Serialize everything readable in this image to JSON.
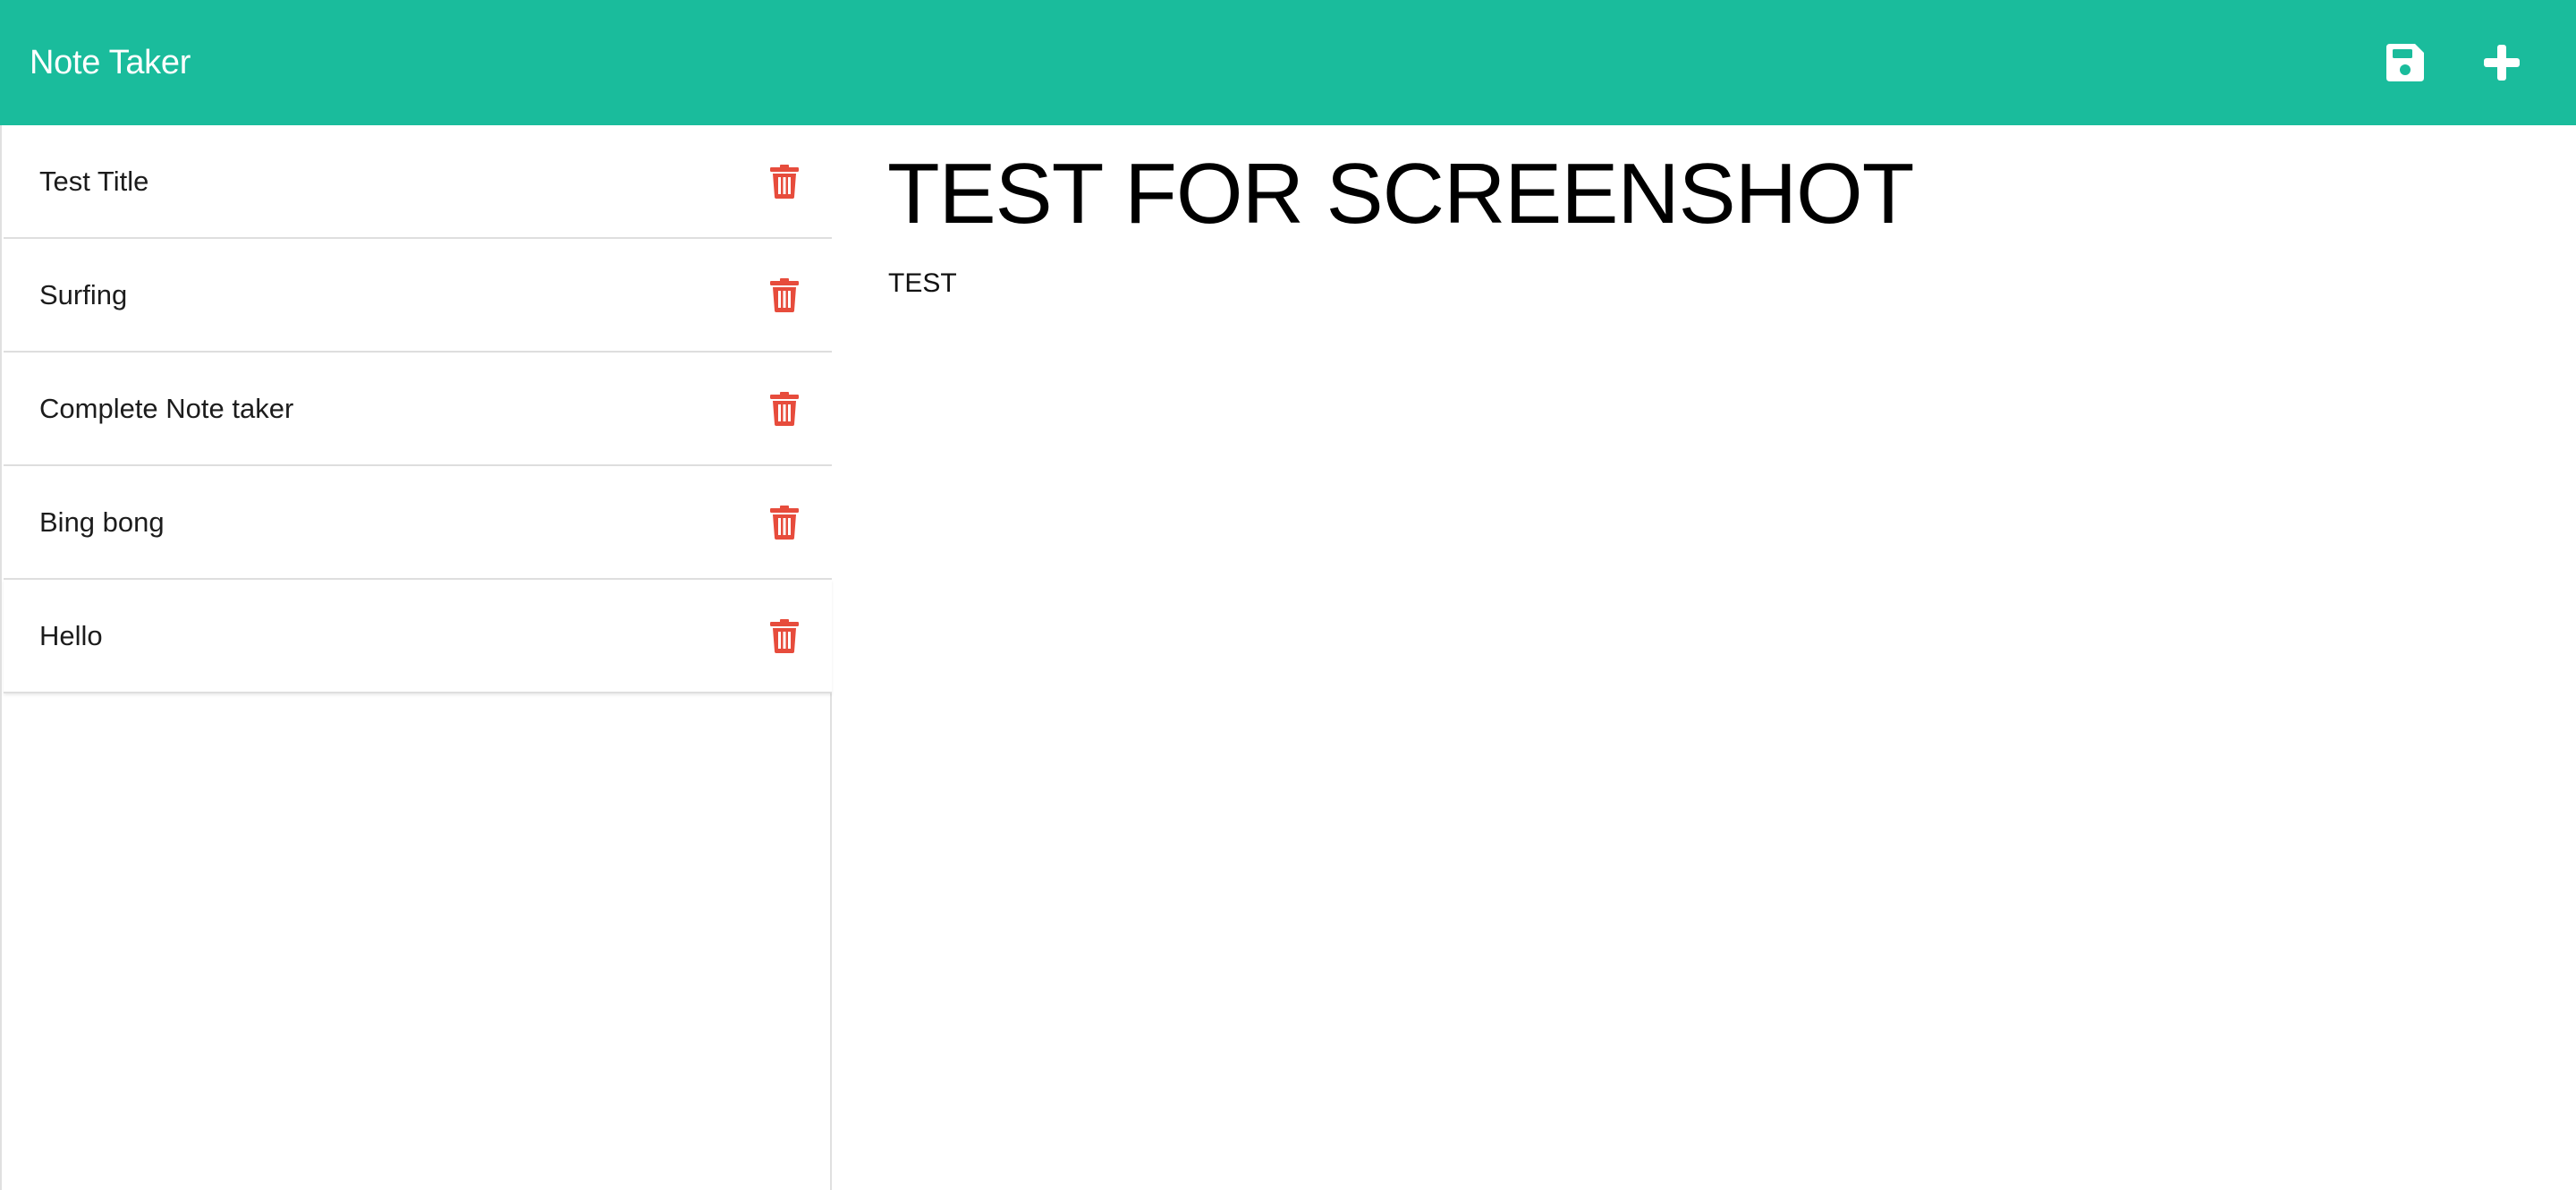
{
  "navbar": {
    "brand": "Note Taker",
    "background": "#1abc9c",
    "save_icon": "floppy-disk-icon",
    "new_icon": "plus-icon"
  },
  "sidebar": {
    "notes": [
      {
        "title": "Test Title",
        "delete_icon": "trash-icon"
      },
      {
        "title": "Surfing",
        "delete_icon": "trash-icon"
      },
      {
        "title": "Complete Note taker",
        "delete_icon": "trash-icon"
      },
      {
        "title": "Bing bong",
        "delete_icon": "trash-icon"
      },
      {
        "title": "Hello",
        "delete_icon": "trash-icon"
      }
    ],
    "delete_color": "#e74c3c"
  },
  "main": {
    "note_title": "TEST FOR SCREENSHOT",
    "note_text": "TEST"
  }
}
